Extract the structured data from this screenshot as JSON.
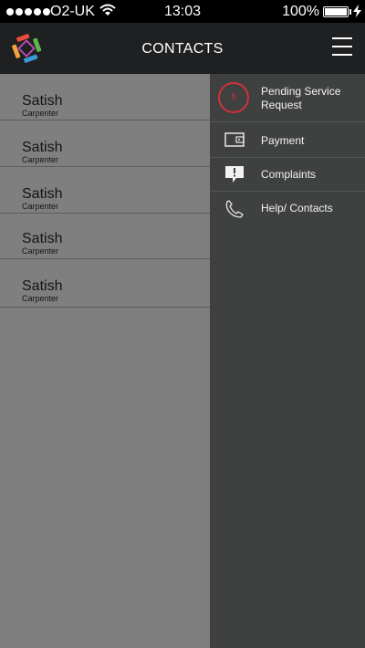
{
  "status_bar": {
    "carrier": "O2-UK",
    "time": "13:03",
    "battery": "100%"
  },
  "header": {
    "title": "CONTACTS"
  },
  "contacts": [
    {
      "name": "Satish",
      "role": "Carpenter"
    },
    {
      "name": "Satish",
      "role": "Carpenter"
    },
    {
      "name": "Satish",
      "role": "Carpenter"
    },
    {
      "name": "Satish",
      "role": "Carpenter"
    },
    {
      "name": "Satish",
      "role": "Carpenter"
    }
  ],
  "menu": {
    "pending": {
      "label": "Pending Service Request",
      "count": "6",
      "icon": "badge"
    },
    "payment": {
      "label": "Payment",
      "icon": "wallet-icon"
    },
    "complaints": {
      "label": "Complaints",
      "icon": "complaint-icon"
    },
    "help": {
      "label": "Help/ Contacts",
      "icon": "phone-icon"
    }
  },
  "colors": {
    "header_bg": "#1f2022",
    "menu_bg": "#3f4140",
    "dimmed_list_bg": "#7f7f7f",
    "badge_red": "#d2313a"
  }
}
